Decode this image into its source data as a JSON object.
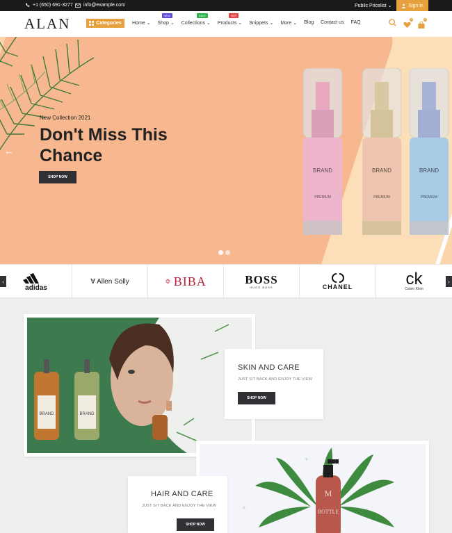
{
  "topbar": {
    "phone": "+1 (650) 691-3277",
    "email": "info@example.com",
    "pricelist": "Public Pricelist",
    "signin": "Sign in"
  },
  "header": {
    "logo": "ALAN",
    "categories_label": "Categories",
    "nav": [
      {
        "label": "Home",
        "dropdown": true
      },
      {
        "label": "Shop",
        "dropdown": true,
        "badge": "NEW",
        "badge_color": "#5b4dd9"
      },
      {
        "label": "Collections",
        "dropdown": true,
        "badge": "SALE",
        "badge_color": "#2cb34a"
      },
      {
        "label": "Products",
        "dropdown": true,
        "badge": "HOT",
        "badge_color": "#e64646"
      },
      {
        "label": "Snippets",
        "dropdown": true
      },
      {
        "label": "More",
        "dropdown": true
      },
      {
        "label": "Blog",
        "dropdown": false
      },
      {
        "label": "Contact us",
        "dropdown": false
      },
      {
        "label": "FAQ",
        "dropdown": false
      }
    ],
    "wishlist_count": "0",
    "cart_count": "0"
  },
  "hero": {
    "subtitle": "New Collection 2021",
    "title": "Don't Miss This Chance",
    "button": "SHOP NOW",
    "bottle_label": "BRAND",
    "bottle_sub": "PREMIUM",
    "colors": {
      "peach": "#f7b890",
      "cream": "#fcdfb8"
    }
  },
  "brands": [
    {
      "name": "adidas"
    },
    {
      "name": "Allen Solly"
    },
    {
      "name": "BIBA"
    },
    {
      "name": "BOSS",
      "sub": "HUGO BOSS"
    },
    {
      "name": "CHANEL"
    },
    {
      "name": "ck",
      "sub": "Calvin Klein"
    }
  ],
  "promo": {
    "skin": {
      "title": "SKIN AND CARE",
      "subtitle": "JUST SIT BACK AND ENJOY THE VIEW",
      "button": "SHOP NOW"
    },
    "hair": {
      "title": "HAIR AND CARE",
      "subtitle": "JUST SIT BACK AND ENJOY THE VIEW",
      "button": "SHOP NOW"
    },
    "bottle_label": "BRAND",
    "bottle2_label": "BOTTLE"
  },
  "accent": "#e6a13c"
}
